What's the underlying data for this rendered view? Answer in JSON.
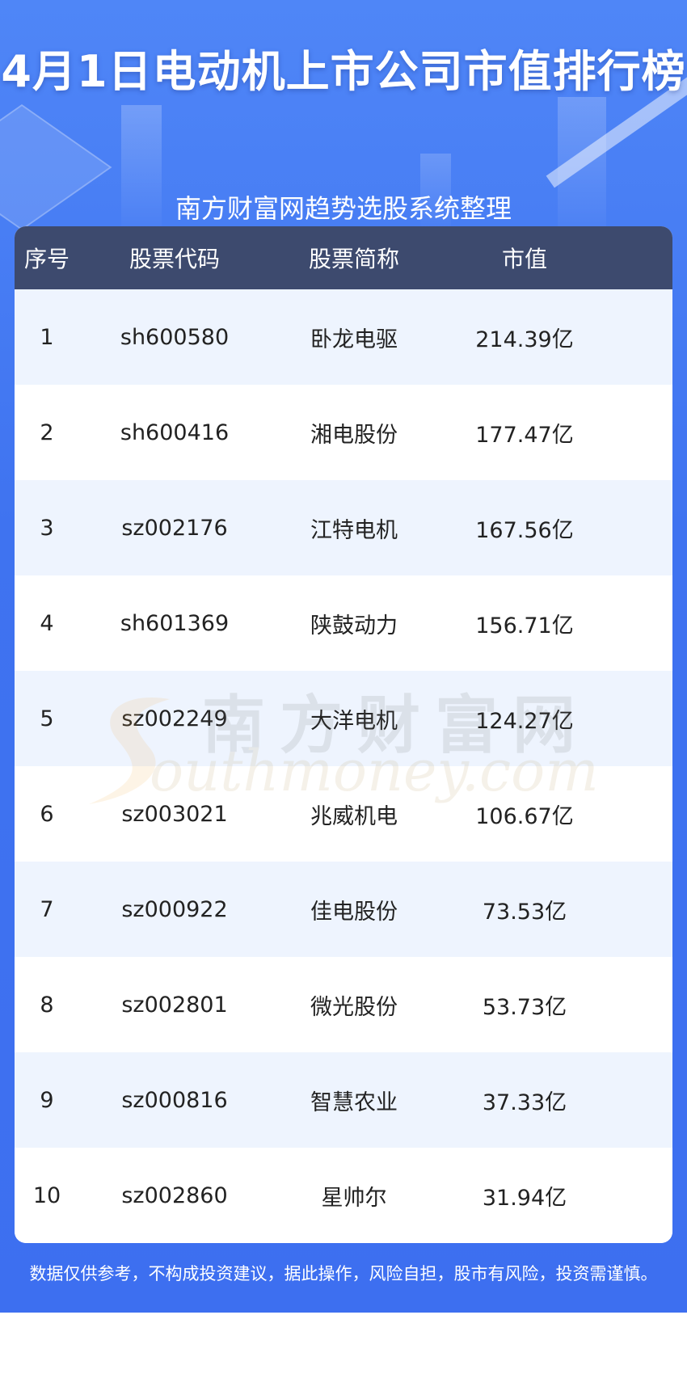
{
  "title": "4月1日电动机上市公司市值排行榜",
  "subtitle": "南方财富网趋势选股系统整理",
  "table": {
    "headers": [
      "序号",
      "股票代码",
      "股票简称",
      "市值"
    ],
    "rows": [
      {
        "rank": "1",
        "code": "sh600580",
        "name": "卧龙电驱",
        "value": "214.39亿"
      },
      {
        "rank": "2",
        "code": "sh600416",
        "name": "湘电股份",
        "value": "177.47亿"
      },
      {
        "rank": "3",
        "code": "sz002176",
        "name": "江特电机",
        "value": "167.56亿"
      },
      {
        "rank": "4",
        "code": "sh601369",
        "name": "陕鼓动力",
        "value": "156.71亿"
      },
      {
        "rank": "5",
        "code": "sz002249",
        "name": "大洋电机",
        "value": "124.27亿"
      },
      {
        "rank": "6",
        "code": "sz003021",
        "name": "兆威机电",
        "value": "106.67亿"
      },
      {
        "rank": "7",
        "code": "sz000922",
        "name": "佳电股份",
        "value": "73.53亿"
      },
      {
        "rank": "8",
        "code": "sz002801",
        "name": "微光股份",
        "value": "53.73亿"
      },
      {
        "rank": "9",
        "code": "sz000816",
        "name": "智慧农业",
        "value": "37.33亿"
      },
      {
        "rank": "10",
        "code": "sz002860",
        "name": "星帅尔",
        "value": "31.94亿"
      }
    ]
  },
  "watermark": {
    "cn": "南方财富网",
    "en": "outhmoney.com"
  },
  "footer": "数据仅供参考，不构成投资建议，据此操作，风险自担，股市有风险，投资需谨慎。",
  "colors": {
    "background": "#3f73f0",
    "header_row": "#3d4a6e",
    "odd_row": "#eef4fe",
    "even_row": "#ffffff"
  }
}
